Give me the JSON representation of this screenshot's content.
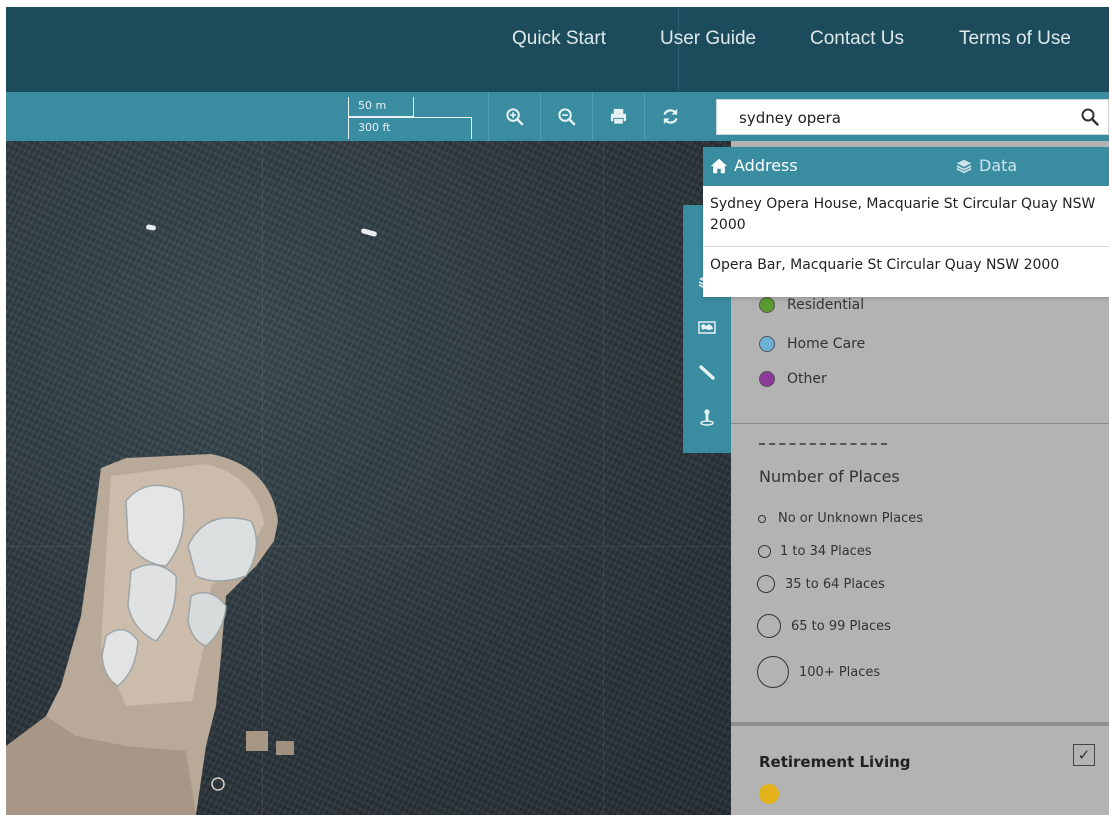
{
  "nav": {
    "items": [
      {
        "label": "Quick Start"
      },
      {
        "label": "User Guide"
      },
      {
        "label": "Contact Us"
      },
      {
        "label": "Terms of Use"
      }
    ]
  },
  "toolbar": {
    "scale_metric": "50 m",
    "scale_imperial": "300 ft",
    "buttons": [
      {
        "icon": "zoom-in-icon"
      },
      {
        "icon": "zoom-out-icon"
      },
      {
        "icon": "print-icon"
      },
      {
        "icon": "refresh-icon"
      }
    ]
  },
  "search": {
    "value": "sydney opera",
    "icon": "search-icon"
  },
  "dropdown": {
    "tabs": [
      {
        "label": "Address",
        "icon": "home-icon",
        "active": true
      },
      {
        "label": "Data",
        "icon": "layers-icon",
        "active": false
      }
    ],
    "results": [
      {
        "label": "Sydney Opera House, Macquarie St Circular Quay NSW 2000"
      },
      {
        "label": "Opera Bar, Macquarie St Circular Quay NSW 2000"
      }
    ]
  },
  "side_tools": [
    {
      "icon": "layers-icon"
    },
    {
      "icon": "basemap-icon"
    },
    {
      "icon": "measure-icon"
    },
    {
      "icon": "location-pin-icon"
    }
  ],
  "legend": {
    "categories": [
      {
        "label": "Residential",
        "color": "#5a9a2e"
      },
      {
        "label": "Home Care",
        "color": "#6fb0d6"
      },
      {
        "label": "Other",
        "color": "#8e3a9c"
      }
    ],
    "places_title": "Number of Places",
    "places": [
      {
        "label": "No or Unknown Places"
      },
      {
        "label": "1 to 34 Places"
      },
      {
        "label": "35 to 64 Places"
      },
      {
        "label": "65 to 99 Places"
      },
      {
        "label": "100+ Places"
      }
    ],
    "retirement": {
      "title": "Retirement Living",
      "checked": true,
      "color": "#e3b11a"
    }
  },
  "colors": {
    "nav_bg": "#1c4c5c",
    "accent": "#3a8ca1",
    "panel_bg": "#b3b3b3"
  }
}
